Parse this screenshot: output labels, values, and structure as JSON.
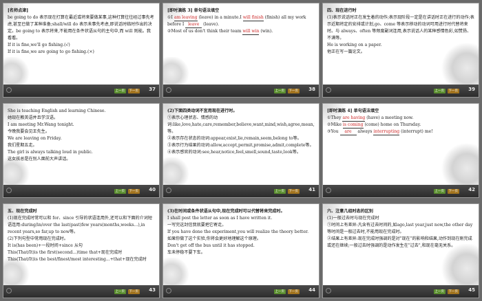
{
  "footer": {
    "up_label": "上一页",
    "next_label": "下一页"
  },
  "slides": [
    {
      "page": "37",
      "lines": [
        "[名师点津]",
        "be going to do 表示现在打算在最近或将来要做某事,这种打算往往经过事先考虑,甚至已做了某种准备;shall/will do 表示未事先考虑,即说话时临时作出的决定。be going to 表示将来,不能用在条件状语从句的主句中,而 will 则能。我看看。",
        "If it is fine,we'll go fishing.(√)",
        "If it is fine,we are going to go fishing.(×)"
      ]
    },
    {
      "page": "38",
      "lines": [
        "[即时演练 3] 单句语法填空",
        "①I ___ (leave) in a minute.I ___ (finish) all my work before I ___ (leave).",
        "②Most of us don't think their team ___ (win)."
      ],
      "answers": [
        "am leaving",
        "will finish",
        "leave",
        "will win"
      ]
    },
    {
      "page": "39",
      "lines": [
        "四、现在进行时",
        "(1)表示说话时正在发生着的动作;表示现阶段一定是在讲话时正在进行的动作;表示近期将定的安排或计划,go、come 等表示移动的动词可用进行时代替将来时。与 always、often 等频度副词连用,表示说话人的某种感情色彩,如赞扬、不满等。",
        "He is working on a paper.",
        "他正在写一篇论文。"
      ]
    },
    {
      "page": "40",
      "lines": [
        "She is teaching English and learning Chinese.",
        "她现在教英语并且学汉语。",
        "I am meeting Mr.Wang tonight.",
        "今晚我要会见王先生。",
        "We are leaving on Friday.",
        "我们星期五走。",
        "The girl is always talking loud in public.",
        "这女孩总是在别人面前大声讲话。"
      ]
    },
    {
      "page": "41",
      "lines": [
        "(2)下面四类动词不宜用现在进行时。",
        "①表示心理状态、情感的动词:like,love,hate,care,remember,believe,want,mind,wish,agree,mean,need等。",
        "②表示存在状态的动词:appear,exist,lie,remain,seem,belong to等。",
        "③表示行为结果的动词:allow,accept,permit,promise,admit,complete等。",
        "④表示感官的动词:see,hear,notice,feel,smell,sound,taste,look等。"
      ]
    },
    {
      "page": "42",
      "lines": [
        "[即时演练 4] 单句语法填空",
        "①They ___ (have) a meeting now.",
        "②Mike ___ (come) home on Thursday.",
        "③You ___ always ___ (interrupt) me!"
      ],
      "answers": [
        "are having",
        "is coming",
        "are",
        "interrupting"
      ]
    },
    {
      "page": "43",
      "lines": [
        "五、现在完成时",
        "(1)现在完成时常可以和 for、since 引导的状语连用外,还可以和下面的介词短语连用:during/in/over the last(past)few years(months,weeks...),in recent years,so far,up to now等。",
        "(2)下列句型中常用现在完成时。",
        "It is(has been)+一段时间+since 从句",
        "This(That/It)is the first(second...)time that+现在完成时",
        "This(That/It)is the best/finest/most interesting...+that+现在完成时"
      ]
    },
    {
      "page": "44",
      "lines": [
        "(3)在时间或条件状语从句中,现在完成时可以代替将来完成时。",
        "I shall post the letter as soon as I have written it.",
        "一写完这封信我就要把它寄走。",
        "If you have done the experiment,you will realize the theory better.",
        "如果你做了这个实验,你将会更好地理解这个原理。",
        "Don't get off the bus until it has stopped.",
        "车未停稳不要下车。"
      ]
    },
    {
      "page": "45",
      "lines": [
        "六、注意几组时态的区别",
        "(1)一般过去时与现在完成时",
        "①时间上有差异:凡含有过去时间的,如ago,last year,just now,the other day等时间是一般过去时,不能用现在完成时。",
        "②结果上有差异:现在完成时强调的是对\"现在\"的影响和结果,动作到现在刚完成或还在继续;一般过去时强调的是动作发生在\"过去\",和现在毫无关系。"
      ]
    }
  ]
}
